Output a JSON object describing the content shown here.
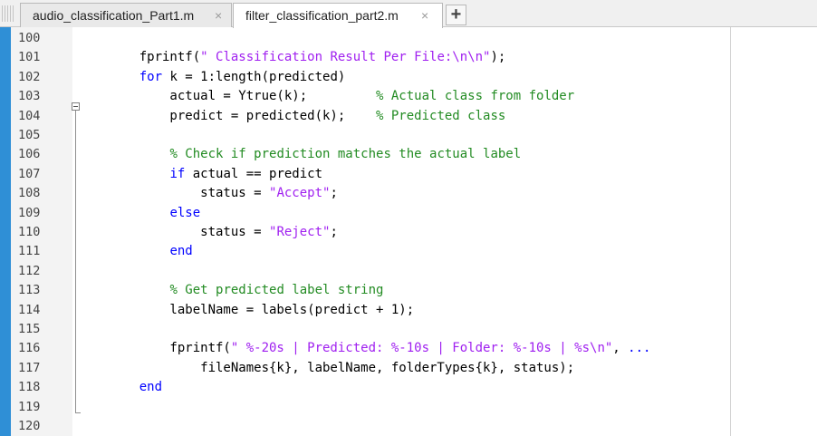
{
  "tabs": [
    {
      "label": "audio_classification_Part1.m",
      "close": "×",
      "active": false
    },
    {
      "label": "filter_classification_part2.m",
      "close": "×",
      "active": true
    }
  ],
  "new_tab_label": "+",
  "lines": [
    {
      "n": "100",
      "tokens": []
    },
    {
      "n": "101",
      "tokens": [
        {
          "t": "    fprintf(",
          "c": "plain"
        },
        {
          "t": "\" Classification Result Per File:\\n\\n\"",
          "c": "str"
        },
        {
          "t": ");",
          "c": "plain"
        }
      ]
    },
    {
      "n": "102",
      "tokens": [
        {
          "t": "    ",
          "c": "plain"
        },
        {
          "t": "for",
          "c": "kw"
        },
        {
          "t": " k = 1:length(predicted)",
          "c": "plain"
        }
      ]
    },
    {
      "n": "103",
      "tokens": [
        {
          "t": "        actual = Ytrue(k);         ",
          "c": "plain"
        },
        {
          "t": "% Actual class from folder",
          "c": "cm"
        }
      ]
    },
    {
      "n": "104",
      "tokens": [
        {
          "t": "        predict = predicted(k);    ",
          "c": "plain"
        },
        {
          "t": "% Predicted class",
          "c": "cm"
        }
      ]
    },
    {
      "n": "105",
      "tokens": []
    },
    {
      "n": "106",
      "tokens": [
        {
          "t": "        ",
          "c": "plain"
        },
        {
          "t": "% Check if prediction matches the actual label",
          "c": "cm"
        }
      ]
    },
    {
      "n": "107",
      "tokens": [
        {
          "t": "        ",
          "c": "plain"
        },
        {
          "t": "if",
          "c": "kw"
        },
        {
          "t": " actual == predict",
          "c": "plain"
        }
      ]
    },
    {
      "n": "108",
      "tokens": [
        {
          "t": "            status = ",
          "c": "plain"
        },
        {
          "t": "\"Accept\"",
          "c": "str"
        },
        {
          "t": ";",
          "c": "plain"
        }
      ]
    },
    {
      "n": "109",
      "tokens": [
        {
          "t": "        ",
          "c": "plain"
        },
        {
          "t": "else",
          "c": "kw"
        }
      ]
    },
    {
      "n": "110",
      "tokens": [
        {
          "t": "            status = ",
          "c": "plain"
        },
        {
          "t": "\"Reject\"",
          "c": "str"
        },
        {
          "t": ";",
          "c": "plain"
        }
      ]
    },
    {
      "n": "111",
      "tokens": [
        {
          "t": "        ",
          "c": "plain"
        },
        {
          "t": "end",
          "c": "kw"
        }
      ]
    },
    {
      "n": "112",
      "tokens": []
    },
    {
      "n": "113",
      "tokens": [
        {
          "t": "        ",
          "c": "plain"
        },
        {
          "t": "% Get predicted label string",
          "c": "cm"
        }
      ]
    },
    {
      "n": "114",
      "tokens": [
        {
          "t": "        labelName = labels(predict + 1);",
          "c": "plain"
        }
      ]
    },
    {
      "n": "115",
      "tokens": []
    },
    {
      "n": "116",
      "tokens": [
        {
          "t": "        fprintf(",
          "c": "plain"
        },
        {
          "t": "\" %-20s | Predicted: %-10s | Folder: %-10s | %s\\n\"",
          "c": "str"
        },
        {
          "t": ", ",
          "c": "plain"
        },
        {
          "t": "...",
          "c": "kw"
        }
      ]
    },
    {
      "n": "117",
      "tokens": [
        {
          "t": "            fileNames{k}, labelName, folderTypes{k}, status);",
          "c": "plain"
        }
      ]
    },
    {
      "n": "118",
      "tokens": [
        {
          "t": "    ",
          "c": "plain"
        },
        {
          "t": "end",
          "c": "kw"
        }
      ]
    },
    {
      "n": "119",
      "tokens": []
    },
    {
      "n": "120",
      "tokens": []
    }
  ],
  "colors": {
    "keyword": "#0000ff",
    "string": "#a020f0",
    "comment": "#228b22",
    "accent_strip": "#2f8fd6"
  }
}
